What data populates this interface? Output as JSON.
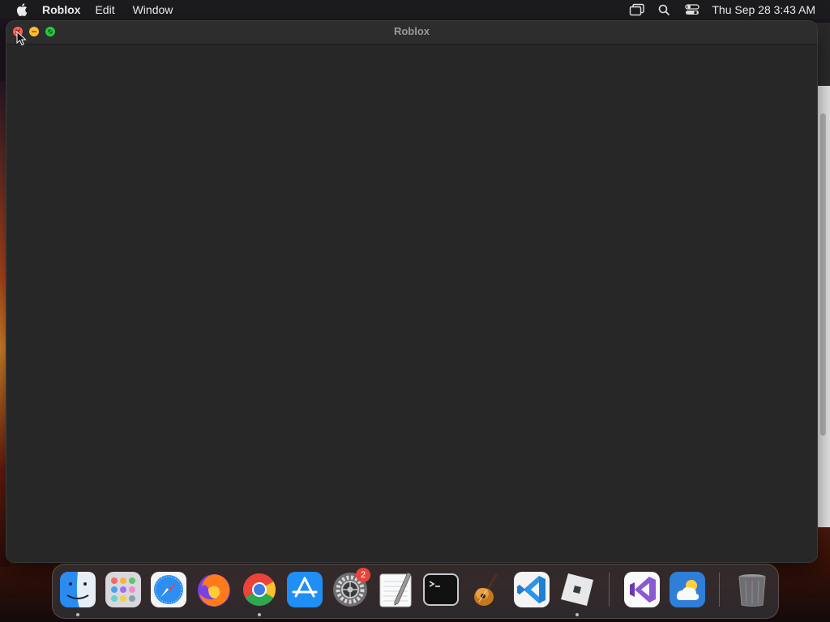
{
  "menubar": {
    "app_name": "Roblox",
    "items": [
      "Edit",
      "Window"
    ],
    "clock": "Thu Sep 28  3:43 AM",
    "status_icons": [
      "screen-mirroring-icon",
      "spotlight-search-icon",
      "control-center-icon"
    ]
  },
  "window": {
    "title": "Roblox",
    "buttons": [
      "close",
      "minimize",
      "zoom"
    ]
  },
  "dock": {
    "items": [
      {
        "name": "Finder",
        "icon": "finder-icon",
        "running": true
      },
      {
        "name": "Launchpad",
        "icon": "launchpad-icon",
        "running": false
      },
      {
        "name": "Safari",
        "icon": "safari-icon",
        "running": false
      },
      {
        "name": "Firefox",
        "icon": "firefox-icon",
        "running": false
      },
      {
        "name": "Google Chrome",
        "icon": "chrome-icon",
        "running": true
      },
      {
        "name": "App Store",
        "icon": "app-store-icon",
        "running": false
      },
      {
        "name": "System Settings",
        "icon": "system-settings-icon",
        "running": false,
        "badge": "2"
      },
      {
        "name": "TextEdit",
        "icon": "textedit-icon",
        "running": false
      },
      {
        "name": "Terminal",
        "icon": "terminal-icon",
        "running": false
      },
      {
        "name": "GarageBand",
        "icon": "garageband-icon",
        "running": false
      },
      {
        "name": "Visual Studio Code",
        "icon": "vscode-icon",
        "running": false
      },
      {
        "name": "Roblox",
        "icon": "roblox-icon",
        "running": true
      },
      {
        "name": "Visual Studio",
        "icon": "visual-studio-icon",
        "running": false
      },
      {
        "name": "Weather",
        "icon": "weather-icon",
        "running": false
      },
      {
        "name": "Trash",
        "icon": "trash-icon",
        "running": false
      }
    ]
  },
  "colors": {
    "window_bg": "#272727",
    "menubar_bg": "#1c1b1d",
    "close": "#ff5f57",
    "minimize": "#febc2e",
    "zoom": "#28c840",
    "badge": "#e8443a"
  }
}
